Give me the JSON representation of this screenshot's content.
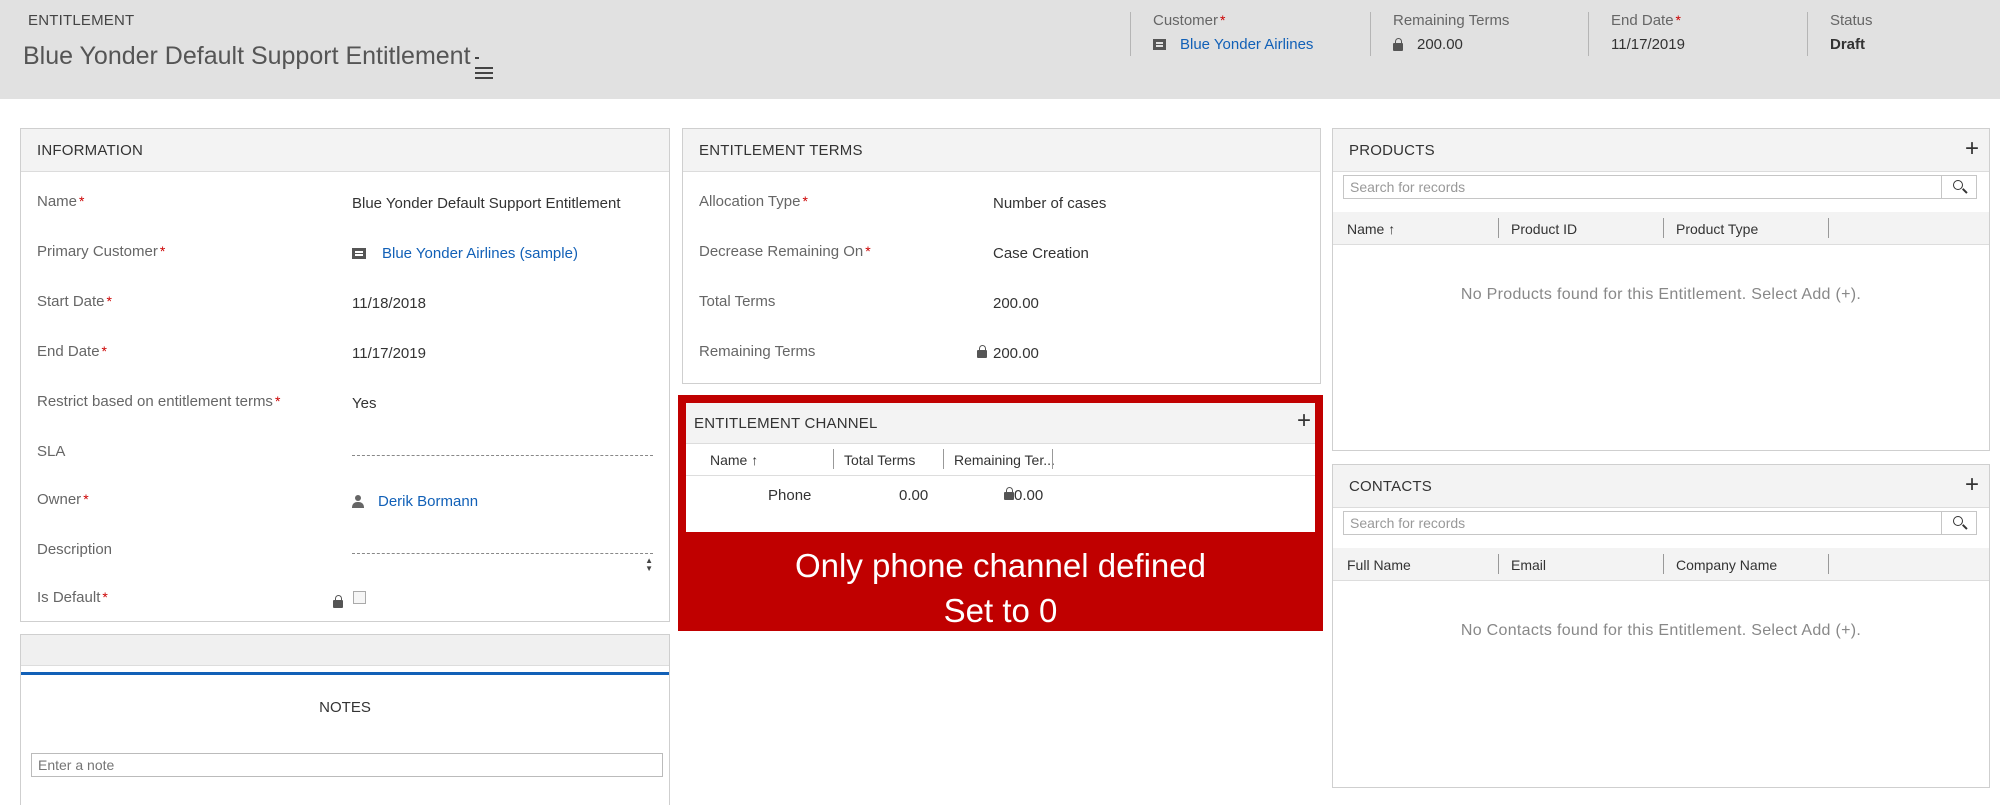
{
  "header": {
    "entity_type": "ENTITLEMENT",
    "title": "Blue Yonder Default Support Entitlement",
    "fields": {
      "customer": {
        "label": "Customer",
        "value": "Blue Yonder Airlines"
      },
      "remaining": {
        "label": "Remaining Terms",
        "value": "200.00"
      },
      "end_date": {
        "label": "End Date",
        "value": "11/17/2019"
      },
      "status": {
        "label": "Status",
        "value": "Draft"
      }
    }
  },
  "information": {
    "title": "INFORMATION",
    "name": {
      "label": "Name",
      "value": "Blue Yonder Default Support Entitlement"
    },
    "primary_customer": {
      "label": "Primary Customer",
      "value": "Blue Yonder Airlines (sample)"
    },
    "start_date": {
      "label": "Start Date",
      "value": "11/18/2018"
    },
    "end_date": {
      "label": "End Date",
      "value": "11/17/2019"
    },
    "restrict": {
      "label": "Restrict based on entitlement terms",
      "value": "Yes"
    },
    "sla": {
      "label": "SLA"
    },
    "owner": {
      "label": "Owner",
      "value": "Derik Bormann"
    },
    "description": {
      "label": "Description"
    },
    "is_default": {
      "label": "Is Default"
    }
  },
  "notes": {
    "tab": "NOTES",
    "placeholder": "Enter a note"
  },
  "terms": {
    "title": "ENTITLEMENT TERMS",
    "allocation": {
      "label": "Allocation Type",
      "value": "Number of cases"
    },
    "decrease": {
      "label": "Decrease Remaining On",
      "value": "Case Creation"
    },
    "total": {
      "label": "Total Terms",
      "value": "200.00"
    },
    "remaining": {
      "label": "Remaining Terms",
      "value": "200.00"
    }
  },
  "channel": {
    "title": "ENTITLEMENT CHANNEL",
    "columns": [
      "Name ↑",
      "Total Terms",
      "Remaining Ter..."
    ],
    "row": {
      "name": "Phone",
      "total": "0.00",
      "remaining": "0.00"
    }
  },
  "callout": {
    "line1": "Only phone channel defined",
    "line2": "Set to 0"
  },
  "products": {
    "title": "PRODUCTS",
    "search_placeholder": "Search for records",
    "columns": [
      "Name ↑",
      "Product ID",
      "Product Type"
    ],
    "empty": "No Products found for this Entitlement. Select Add (+)."
  },
  "contacts": {
    "title": "CONTACTS",
    "search_placeholder": "Search for records",
    "columns": [
      "Full Name",
      "Email",
      "Company Name"
    ],
    "empty": "No Contacts found for this Entitlement. Select Add (+)."
  },
  "colors": {
    "accent": "#1160b7",
    "callout": "#c00000",
    "required": "#cc0000"
  }
}
